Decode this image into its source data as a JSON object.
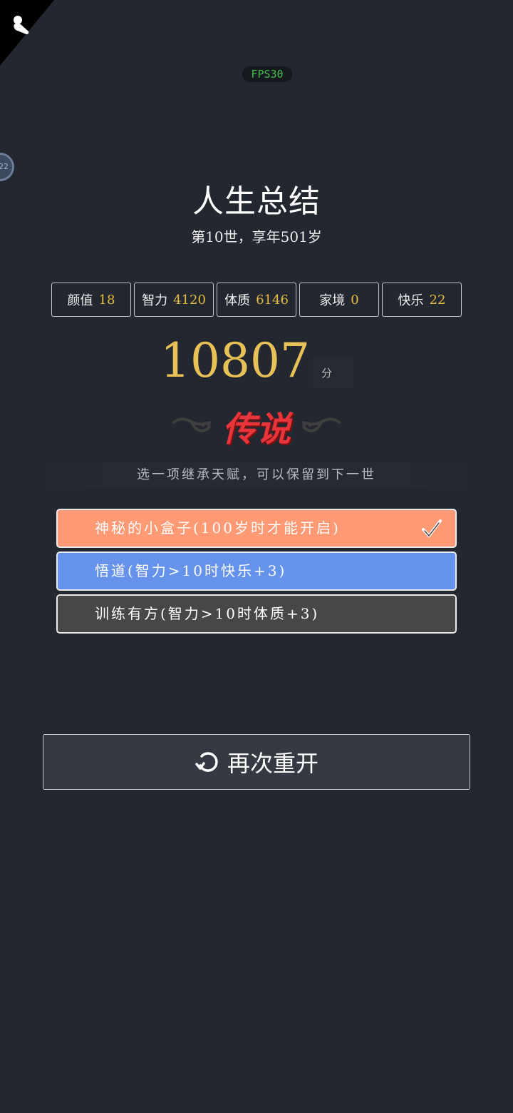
{
  "overlay": {
    "fps_label": "FPS30",
    "side_badge": "22"
  },
  "summary": {
    "title": "人生总结",
    "subtitle": "第10世，享年501岁"
  },
  "stats": [
    {
      "name": "颜值",
      "value": "18"
    },
    {
      "name": "智力",
      "value": "4120"
    },
    {
      "name": "体质",
      "value": "6146"
    },
    {
      "name": "家境",
      "value": "0"
    },
    {
      "name": "快乐",
      "value": "22"
    }
  ],
  "score": {
    "value": "10807",
    "unit": "分"
  },
  "grade": {
    "label": "传说",
    "color": "#e8343b"
  },
  "inherit": {
    "hint": "选一项继承天赋，可以保留到下一世",
    "options": [
      {
        "label": "神秘的小盒子(100岁时才能开启)",
        "selected": true,
        "color": "#ff9a74"
      },
      {
        "label": "悟道(智力>10时快乐+3)",
        "selected": false,
        "color": "#6592ea"
      },
      {
        "label": "训练有方(智力>10时体质+3)",
        "selected": false,
        "color": "#474747"
      }
    ]
  },
  "actions": {
    "restart_label": "再次重开"
  },
  "icons": {
    "corner": "pawn-icon",
    "check": "check-icon",
    "restart": "refresh-icon"
  }
}
